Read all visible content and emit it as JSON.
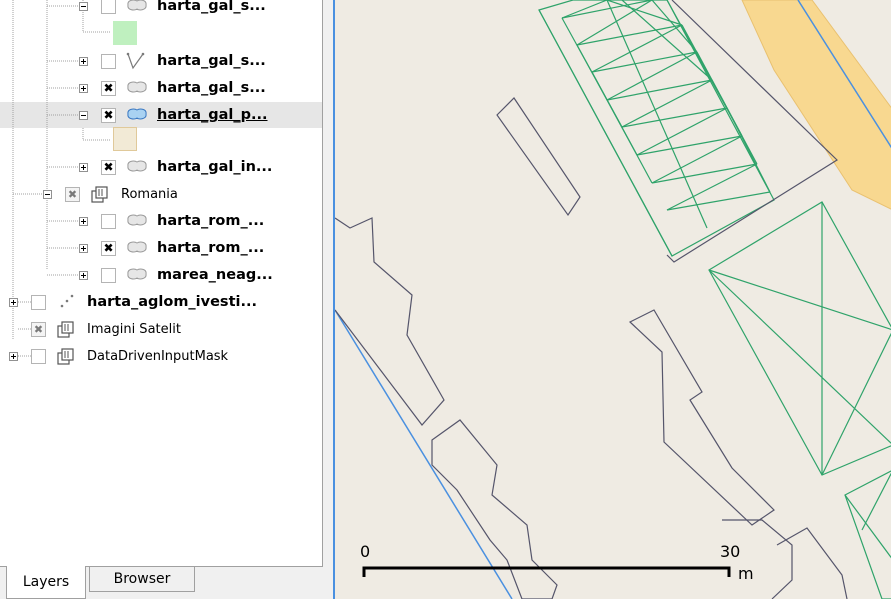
{
  "layers_tree": [
    {
      "depth": 2,
      "expander": "minus",
      "check": "off",
      "icon": "polygon-layer-icon",
      "label": "harta_gal_s...",
      "style": "bold"
    },
    {
      "depth": 2,
      "expander": "plus",
      "check": "off",
      "icon": "line-layer-icon",
      "label": "harta_gal_s...",
      "style": "bold"
    },
    {
      "depth": 2,
      "expander": "plus",
      "check": "on",
      "icon": "polygon-layer-icon",
      "label": "harta_gal_s...",
      "style": "bold"
    },
    {
      "depth": 2,
      "expander": "minus",
      "check": "on",
      "icon": "polygon-layer-icon-active",
      "label": "harta_gal_p...",
      "style": "bold-underline",
      "selected": true
    },
    {
      "depth": 2,
      "expander": "plus",
      "check": "on",
      "icon": "polygon-layer-icon",
      "label": "harta_gal_in...",
      "style": "bold"
    },
    {
      "depth": 1,
      "expander": "minus",
      "check": "partial",
      "icon": "group-icon",
      "label": "Romania",
      "style": "normal"
    },
    {
      "depth": 2,
      "expander": "plus",
      "check": "off",
      "icon": "polygon-layer-icon",
      "label": "harta_rom_...",
      "style": "bold"
    },
    {
      "depth": 2,
      "expander": "plus",
      "check": "on",
      "icon": "polygon-layer-icon",
      "label": "harta_rom_...",
      "style": "bold"
    },
    {
      "depth": 2,
      "expander": "plus",
      "check": "off",
      "icon": "polygon-layer-icon",
      "label": "marea_neag...",
      "style": "bold"
    },
    {
      "depth": 0,
      "expander": "plus",
      "check": "off",
      "icon": "point-layer-icon",
      "label": "harta_aglom_ivesti...",
      "style": "bold"
    },
    {
      "depth": 0,
      "expander": "none",
      "check": "partial",
      "icon": "group-icon",
      "label": "Imagini Satelit",
      "style": "normal"
    },
    {
      "depth": 0,
      "expander": "plus",
      "check": "off",
      "icon": "group-icon",
      "label": "DataDrivenInputMask",
      "style": "normal"
    }
  ],
  "legend_swatches": [
    {
      "color": "#bff0bf",
      "border": "#bff0bf"
    },
    {
      "color": "#f2ead6",
      "border": "#e0c99a"
    }
  ],
  "tabs": {
    "layers": "Layers",
    "browser": "Browser"
  },
  "scale_bar": {
    "start": "0",
    "end": "30",
    "unit": "m"
  },
  "colors": {
    "map_background": "#efebe3",
    "building_outline": "#55556b",
    "hatched_polygon": "#2fa36a",
    "road_fill": "#f8d890",
    "water_line": "#4a90e0",
    "selection_row": "#e6e6e6"
  }
}
